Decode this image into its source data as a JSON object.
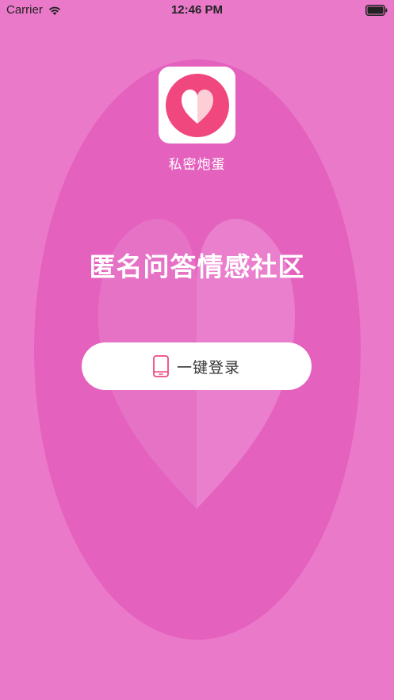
{
  "status_bar": {
    "carrier": "Carrier",
    "time": "12:46 PM",
    "icons": [
      "wifi-icon",
      "battery-icon"
    ]
  },
  "app": {
    "name": "私密炮蛋",
    "icon": "heart-logo-icon"
  },
  "main": {
    "slogan": "匿名问答情感社区",
    "login_button": {
      "label": "一键登录",
      "icon": "phone-icon"
    }
  },
  "colors": {
    "background": "#EA7AC9",
    "oval": "#E461BE",
    "accent": "#F0487E",
    "button_bg": "#FFFFFF",
    "button_text": "#333333"
  }
}
